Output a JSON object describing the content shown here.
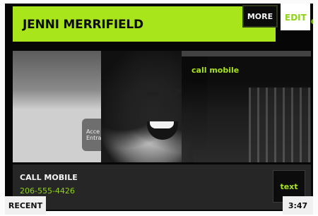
{
  "header": {
    "contact_name": "JENNI MERRIFIELD",
    "more_label": "MORE",
    "edit_label": "EDIT"
  },
  "photo": {
    "call_mobile_label": "call mobile",
    "sign_text": "Acce\nEntra"
  },
  "action": {
    "title": "CALL MOBILE",
    "number": "206-555-4426",
    "text_button_label": "text"
  },
  "status": {
    "recent_label": "RECENT",
    "time": "3:47"
  },
  "colors": {
    "accent_green": "#a8e51a",
    "screen_bg": "#060606",
    "panel_bg": "#262626"
  }
}
